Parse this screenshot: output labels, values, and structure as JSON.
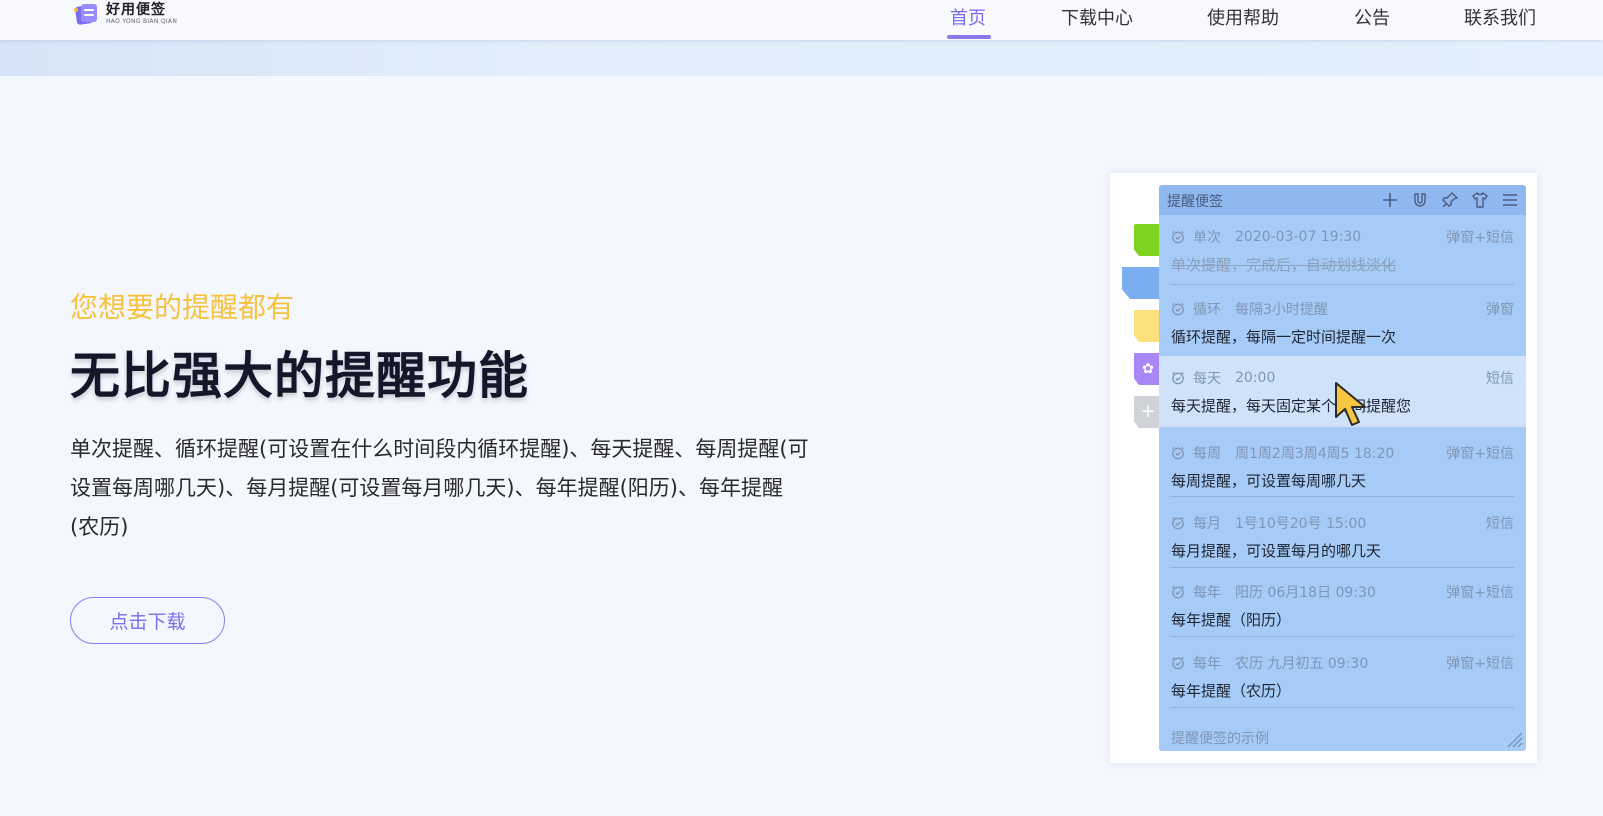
{
  "logo": {
    "name_cn": "好用便签",
    "name_en": "HAO YONG BIAN QIAN"
  },
  "nav": {
    "items": [
      {
        "label": "首页",
        "active": true
      },
      {
        "label": "下载中心",
        "active": false
      },
      {
        "label": "使用帮助",
        "active": false
      },
      {
        "label": "公告",
        "active": false
      },
      {
        "label": "联系我们",
        "active": false
      }
    ]
  },
  "hero": {
    "subtitle": "您想要的提醒都有",
    "headline": "无比强大的提醒功能",
    "description": "单次提醒、循环提醒(可设置在什么时间段内循环提醒)、每天提醒、每周提醒(可设置每周哪几天)、每月提醒(可设置每月哪几天)、每年提醒(阳历)、每年提醒(农历)",
    "download_button": "点击下载"
  },
  "note_widget": {
    "title": "提醒便签",
    "header_icons": [
      "plus-icon",
      "magnet-icon",
      "pin-icon",
      "shirt-icon",
      "menu-icon"
    ],
    "side_tabs": [
      {
        "color": "#7fd320",
        "icon": ""
      },
      {
        "color": "#7aaef0",
        "icon": ""
      },
      {
        "color": "#fbe07c",
        "icon": ""
      },
      {
        "color": "#a888f6",
        "icon": "group-icon"
      },
      {
        "color": "#cfd3d8",
        "icon": "plus-icon"
      }
    ],
    "reminders": [
      {
        "kind": "单次",
        "when": "2020-03-07 19:30",
        "mode": "弹窗+短信",
        "text": "单次提醒，完成后，自动划线淡化",
        "done": true,
        "highlight": false
      },
      {
        "kind": "循环",
        "when": "每隔3小时提醒",
        "mode": "弹窗",
        "text": "循环提醒，每隔一定时间提醒一次",
        "done": false,
        "highlight": false
      },
      {
        "kind": "每天",
        "when": "20:00",
        "mode": "短信",
        "text": "每天提醒，每天固定某个时间提醒您",
        "done": false,
        "highlight": true
      },
      {
        "kind": "每周",
        "when": "周1周2周3周4周5  18:20",
        "mode": "弹窗+短信",
        "text": "每周提醒，可设置每周哪几天",
        "done": false,
        "highlight": false
      },
      {
        "kind": "每月",
        "when": "1号10号20号  15:00",
        "mode": "短信",
        "text": "每月提醒，可设置每月的哪几天",
        "done": false,
        "highlight": false
      },
      {
        "kind": "每年",
        "when": "阳历  06月18日   09:30",
        "mode": "弹窗+短信",
        "text": "每年提醒（阳历）",
        "done": false,
        "highlight": false
      },
      {
        "kind": "每年",
        "when": "农历  九月初五   09:30",
        "mode": "弹窗+短信",
        "text": "每年提醒（农历）",
        "done": false,
        "highlight": false
      }
    ],
    "footer": "提醒便签的示例"
  },
  "colors": {
    "accent": "#7d6bea",
    "subtitle": "#f6c23e",
    "note_bg": "#a6cbf6",
    "note_header": "#8fb8f0"
  }
}
